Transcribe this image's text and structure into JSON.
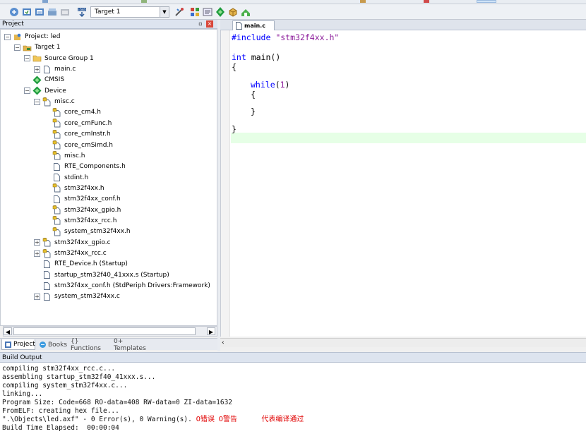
{
  "toolbar": {
    "target_label": "Target 1"
  },
  "project_panel": {
    "title": "Project",
    "pin_icon": "pin-icon",
    "close_icon": "close-icon",
    "tree": [
      {
        "label": "Project: led",
        "level": 0,
        "expander": "−",
        "icon": "project-icon"
      },
      {
        "label": "Target 1",
        "level": 1,
        "expander": "−",
        "icon": "target-icon"
      },
      {
        "label": "Source Group 1",
        "level": 2,
        "expander": "−",
        "icon": "folder-icon"
      },
      {
        "label": "main.c",
        "level": 3,
        "expander": "+",
        "icon": "file-icon"
      },
      {
        "label": "CMSIS",
        "level": 2,
        "expander": "",
        "icon": "diamond-icon"
      },
      {
        "label": "Device",
        "level": 2,
        "expander": "−",
        "icon": "diamond-icon"
      },
      {
        "label": "misc.c",
        "level": 3,
        "expander": "−",
        "icon": "locked-file-icon"
      },
      {
        "label": "core_cm4.h",
        "level": 4,
        "expander": "",
        "icon": "locked-file-icon"
      },
      {
        "label": "core_cmFunc.h",
        "level": 4,
        "expander": "",
        "icon": "locked-file-icon"
      },
      {
        "label": "core_cmInstr.h",
        "level": 4,
        "expander": "",
        "icon": "locked-file-icon"
      },
      {
        "label": "core_cmSimd.h",
        "level": 4,
        "expander": "",
        "icon": "locked-file-icon"
      },
      {
        "label": "misc.h",
        "level": 4,
        "expander": "",
        "icon": "locked-file-icon"
      },
      {
        "label": "RTE_Components.h",
        "level": 4,
        "expander": "",
        "icon": "file-icon"
      },
      {
        "label": "stdint.h",
        "level": 4,
        "expander": "",
        "icon": "file-icon"
      },
      {
        "label": "stm32f4xx.h",
        "level": 4,
        "expander": "",
        "icon": "locked-file-icon"
      },
      {
        "label": "stm32f4xx_conf.h",
        "level": 4,
        "expander": "",
        "icon": "file-icon"
      },
      {
        "label": "stm32f4xx_gpio.h",
        "level": 4,
        "expander": "",
        "icon": "locked-file-icon"
      },
      {
        "label": "stm32f4xx_rcc.h",
        "level": 4,
        "expander": "",
        "icon": "locked-file-icon"
      },
      {
        "label": "system_stm32f4xx.h",
        "level": 4,
        "expander": "",
        "icon": "locked-file-icon"
      },
      {
        "label": "stm32f4xx_gpio.c",
        "level": 3,
        "expander": "+",
        "icon": "locked-file-icon"
      },
      {
        "label": "stm32f4xx_rcc.c",
        "level": 3,
        "expander": "+",
        "icon": "locked-file-icon"
      },
      {
        "label": "RTE_Device.h (Startup)",
        "level": 3,
        "expander": "",
        "icon": "file-icon"
      },
      {
        "label": "startup_stm32f40_41xxx.s (Startup)",
        "level": 3,
        "expander": "",
        "icon": "file-icon"
      },
      {
        "label": "stm32f4xx_conf.h (StdPeriph Drivers:Framework)",
        "level": 3,
        "expander": "",
        "icon": "file-icon"
      },
      {
        "label": "system_stm32f4xx.c",
        "level": 3,
        "expander": "+",
        "icon": "file-icon"
      }
    ],
    "tabs": [
      {
        "label": "Project",
        "icon": "project-tab-icon",
        "active": true
      },
      {
        "label": "Books",
        "icon": "books-icon",
        "active": false
      },
      {
        "label": "{} Functions",
        "icon": "",
        "active": false
      },
      {
        "label": "0+ Templates",
        "icon": "",
        "active": false
      }
    ]
  },
  "editor": {
    "tab_label": "main.c",
    "code": {
      "include_kw": "#include",
      "include_str": "\"stm32f4xx.h\"",
      "int_kw": "int",
      "main_sig": " main()",
      "open_brace": "{",
      "while_kw": "while",
      "while_open": "(",
      "while_num": "1",
      "while_close": ")",
      "inner_open": "{",
      "inner_close": "}",
      "close_brace": "}"
    }
  },
  "build_output": {
    "title": "Build Output",
    "lines": [
      "compiling stm32f4xx_rcc.c...",
      "assembling startup_stm32f40_41xxx.s...",
      "compiling system_stm32f4xx.c...",
      "linking...",
      "Program Size: Code=668 RO-data=408 RW-data=0 ZI-data=1632",
      "FromELF: creating hex file...",
      "\".\\Objects\\led.axf\" - 0 Error(s), 0 Warning(s).",
      "Build Time Elapsed:  00:00:04"
    ],
    "annotation_errors": "0错误",
    "annotation_warnings": "0警告",
    "annotation_pass": "代表编译通过"
  }
}
